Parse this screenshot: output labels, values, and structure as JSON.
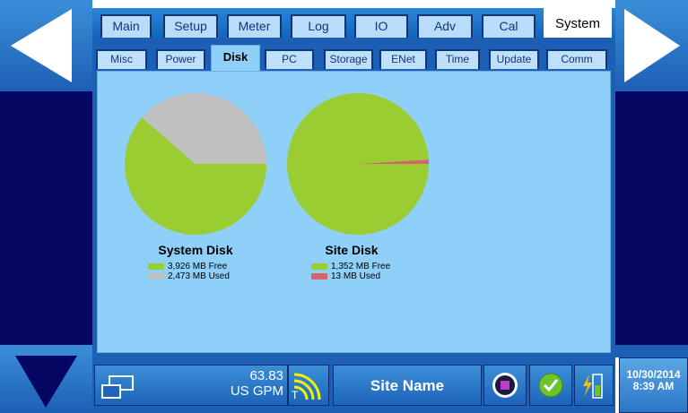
{
  "tabs": [
    {
      "label": "Main",
      "active": false
    },
    {
      "label": "Setup",
      "active": false
    },
    {
      "label": "Meter",
      "active": false
    },
    {
      "label": "Log",
      "active": false
    },
    {
      "label": "IO",
      "active": false
    },
    {
      "label": "Adv",
      "active": false
    },
    {
      "label": "Cal",
      "active": false
    },
    {
      "label": "System",
      "active": true
    }
  ],
  "subtabs": [
    {
      "label": "Misc",
      "active": false
    },
    {
      "label": "Power",
      "active": false
    },
    {
      "label": "Disk",
      "active": true
    },
    {
      "label": "PC",
      "active": false
    },
    {
      "label": "Storage",
      "active": false
    },
    {
      "label": "ENet",
      "active": false
    },
    {
      "label": "Time",
      "active": false
    },
    {
      "label": "Update",
      "active": false
    },
    {
      "label": "Comm",
      "active": false
    }
  ],
  "disks": {
    "system": {
      "title": "System Disk",
      "free_label": "3,926 MB Free",
      "used_label": "2,473 MB Used",
      "free_mb": 3926,
      "used_mb": 2473
    },
    "site": {
      "title": "Site Disk",
      "free_label": "1,352 MB Free",
      "used_label": "13 MB Used",
      "free_mb": 1352,
      "used_mb": 13
    }
  },
  "colors": {
    "free": "#9acd32",
    "system_used": "#c0c0c0",
    "site_used": "#d9636b",
    "content_bg": "#8fd0f9",
    "frame_blue": "#1d5fb5",
    "side_navy": "#050662"
  },
  "status": {
    "flow_value": "63.83",
    "flow_unit": "US GPM",
    "signal_label": "T",
    "site_name": "Site Name",
    "date": "10/30/2014",
    "time": "8:39 AM"
  },
  "icons": {
    "prev": "left-arrow-icon",
    "next": "right-arrow-icon",
    "down": "down-arrow-icon",
    "display": "display-windows-icon",
    "signal": "signal-icon",
    "stop": "stop-icon",
    "ok": "check-icon",
    "power": "power-battery-icon"
  }
}
